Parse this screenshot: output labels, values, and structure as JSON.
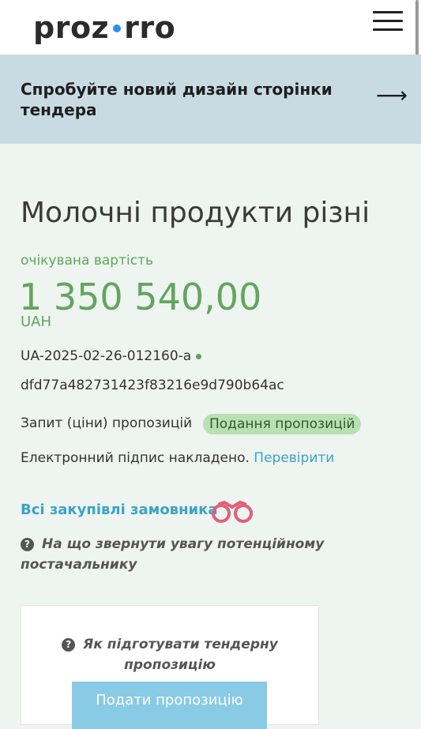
{
  "header": {
    "logo_left": "proz",
    "logo_right": "rro",
    "menu_icon": "hamburger-menu-icon"
  },
  "banner": {
    "text": "Спробуйте новий дизайн сторінки тендера",
    "arrow_icon": "arrow-right-icon",
    "arrow": "⟶"
  },
  "tender": {
    "title": "Молочні продукти різні",
    "expected_label": "очікувана вартість",
    "amount": "1 350 540,00",
    "currency": "UAH",
    "id": "UA-2025-02-26-012160-a",
    "hash": "dfd77a482731423f83216e9d790b64ac",
    "procedure_type": "Запит (ціни) пропозицій",
    "status": "Подання пропозицій",
    "signature_text": "Електронний підпис накладено.",
    "verify_link": "Перевірити",
    "all_purchases_link": "Всі закупівлі замовника",
    "binoculars_icon": "binoculars-icon",
    "attention_text": "На що звернути увагу потенційному постачальнику",
    "question_icon": "question-circle-icon"
  },
  "card": {
    "how_to_text": "Як підготувати тендерну пропозицію",
    "submit_label": "Подати пропозицію"
  },
  "colors": {
    "green": "#62a55f",
    "link": "#3aa3c9",
    "banner_bg": "#c9dbe2",
    "page_bg": "#eef4ef",
    "badge_bg": "#b8e0b2",
    "button_bg": "#89cbe4"
  }
}
